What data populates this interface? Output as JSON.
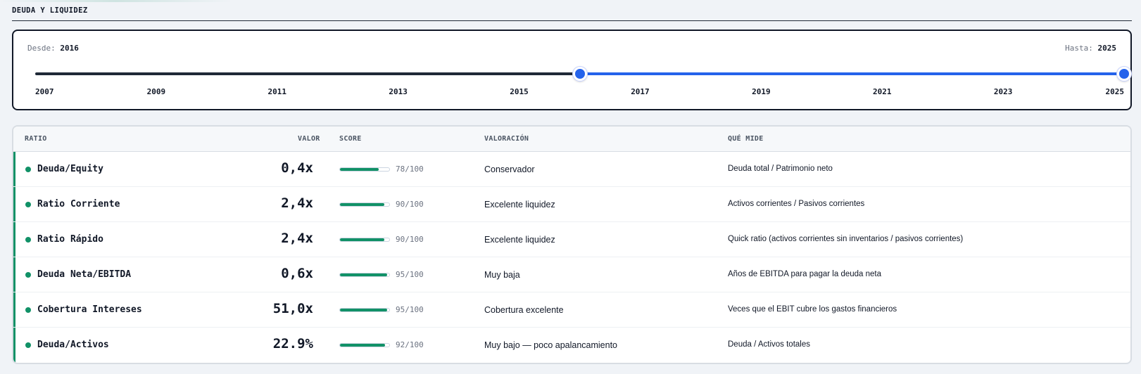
{
  "section": {
    "title": "DEUDA Y LIQUIDEZ"
  },
  "range": {
    "from_label": "Desde:",
    "from_value": "2016",
    "to_label": "Hasta:",
    "to_value": "2025",
    "min_year": 2007,
    "max_year": 2025,
    "ticks": [
      "2007",
      "2009",
      "2011",
      "2013",
      "2015",
      "2017",
      "2019",
      "2021",
      "2023",
      "2025"
    ],
    "colors": {
      "track": "#1f2937",
      "selected": "#2563eb"
    }
  },
  "table": {
    "headers": {
      "ratio": "RATIO",
      "valor": "VALOR",
      "score": "SCORE",
      "valoracion": "VALORACIÓN",
      "mide": "QUÉ MIDE"
    },
    "rows": [
      {
        "name": "Deuda/Equity",
        "valor": "0,4x",
        "score": 78,
        "score_text": "78/100",
        "valoracion": "Conservador",
        "mide": "Deuda total / Patrimonio neto"
      },
      {
        "name": "Ratio Corriente",
        "valor": "2,4x",
        "score": 90,
        "score_text": "90/100",
        "valoracion": "Excelente liquidez",
        "mide": "Activos corrientes / Pasivos corrientes"
      },
      {
        "name": "Ratio Rápido",
        "valor": "2,4x",
        "score": 90,
        "score_text": "90/100",
        "valoracion": "Excelente liquidez",
        "mide": "Quick ratio (activos corrientes sin inventarios / pasivos corrientes)"
      },
      {
        "name": "Deuda Neta/EBITDA",
        "valor": "0,6x",
        "score": 95,
        "score_text": "95/100",
        "valoracion": "Muy baja",
        "mide": "Años de EBITDA para pagar la deuda neta"
      },
      {
        "name": "Cobertura Intereses",
        "valor": "51,0x",
        "score": 95,
        "score_text": "95/100",
        "valoracion": "Cobertura excelente",
        "mide": "Veces que el EBIT cubre los gastos financieros"
      },
      {
        "name": "Deuda/Activos",
        "valor": "22.9%",
        "score": 92,
        "score_text": "92/100",
        "valoracion": "Muy bajo — poco apalancamiento",
        "mide": "Deuda / Activos totales"
      }
    ],
    "colors": {
      "status": "#119167"
    }
  }
}
